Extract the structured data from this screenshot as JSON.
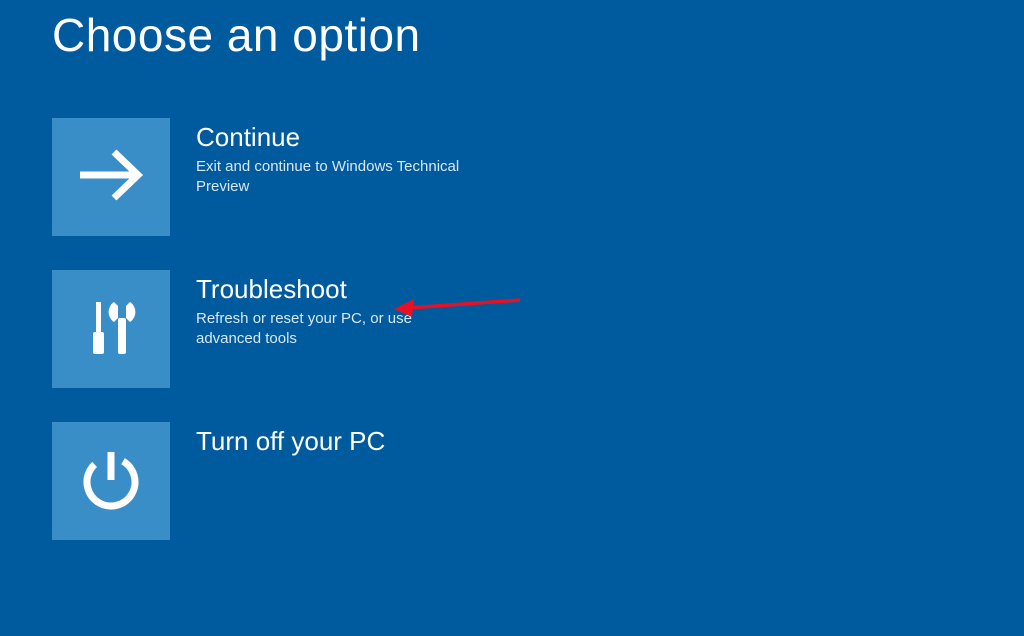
{
  "page": {
    "title": "Choose an option"
  },
  "options": [
    {
      "icon": "arrow-right",
      "title": "Continue",
      "description": "Exit and continue to Windows Technical Preview"
    },
    {
      "icon": "tools",
      "title": "Troubleshoot",
      "description": "Refresh or reset your PC, or use advanced tools"
    },
    {
      "icon": "power",
      "title": "Turn off your PC",
      "description": ""
    }
  ],
  "colors": {
    "background": "#005a9e",
    "tile": "#3a8ec8",
    "annotation_arrow": "#e81123"
  }
}
